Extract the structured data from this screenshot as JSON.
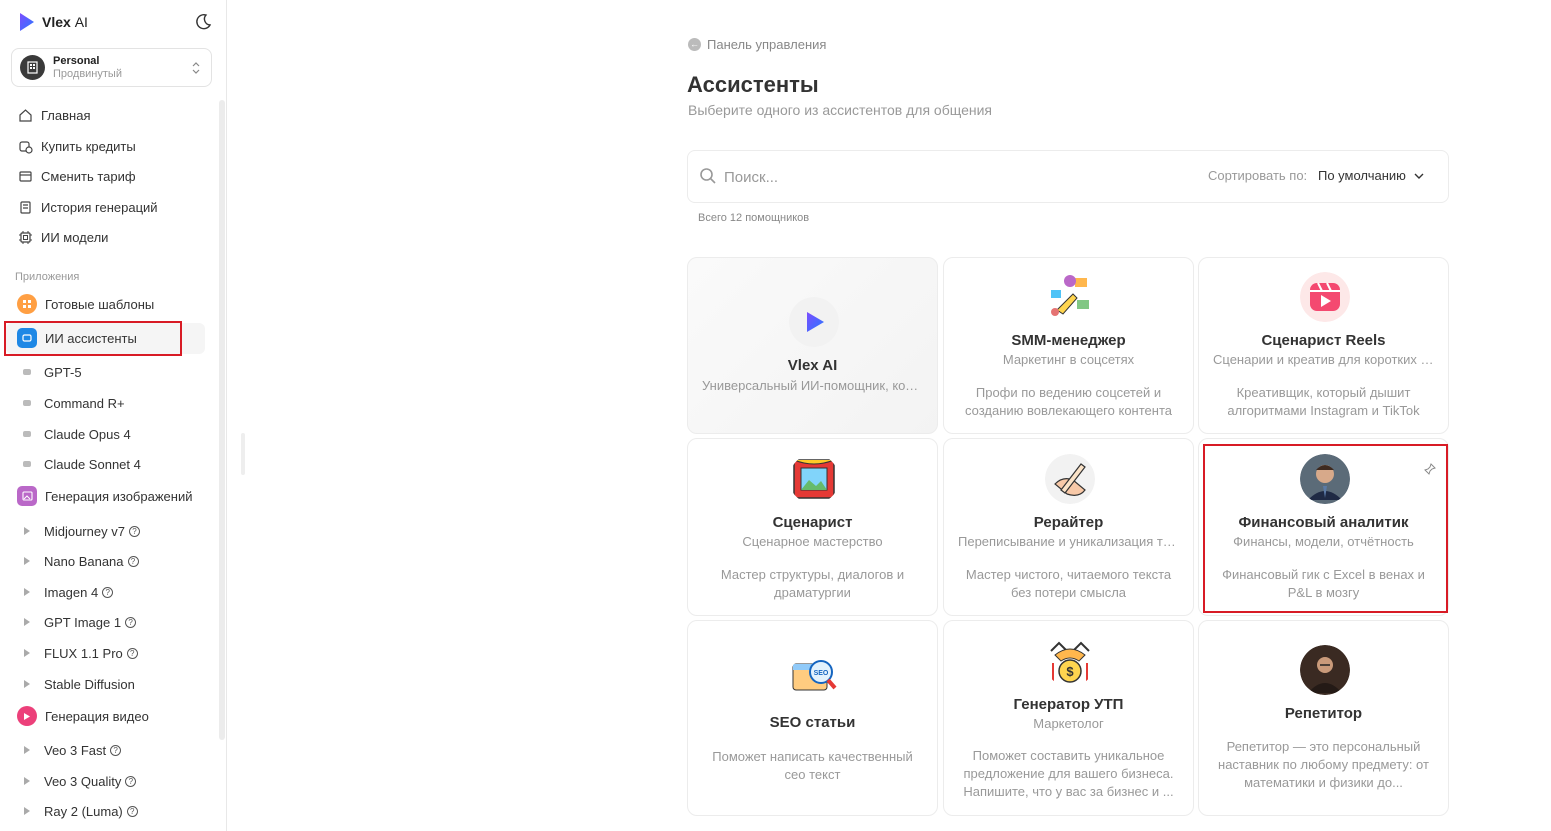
{
  "app": {
    "name": "Vlex",
    "name_suffix": "AI"
  },
  "workspace": {
    "name": "Personal",
    "plan": "Продвинутый"
  },
  "nav": [
    {
      "label": "Главная",
      "icon": "home-icon"
    },
    {
      "label": "Купить кредиты",
      "icon": "credits-icon"
    },
    {
      "label": "Сменить тариф",
      "icon": "plan-icon"
    },
    {
      "label": "История генераций",
      "icon": "history-icon"
    },
    {
      "label": "ИИ модели",
      "icon": "chip-icon"
    }
  ],
  "apps_section_label": "Приложения",
  "apps": {
    "templates": "Готовые шаблоны",
    "assistants": "ИИ ассистенты",
    "assistant_models": [
      "GPT-5",
      "Command R+",
      "Claude Opus 4",
      "Claude Sonnet 4"
    ],
    "image_gen": "Генерация изображений",
    "image_models": [
      "Midjourney v7",
      "Nano Banana",
      "Imagen 4",
      "GPT Image 1",
      "FLUX 1.1 Pro",
      "Stable Diffusion"
    ],
    "video_gen": "Генерация видео",
    "video_models": [
      "Veo 3 Fast",
      "Veo 3 Quality",
      "Ray 2 (Luma)"
    ]
  },
  "main": {
    "back_label": "Панель управления",
    "title": "Ассистенты",
    "subtitle": "Выберите одного из ассистентов для общения",
    "search_placeholder": "Поиск...",
    "sort_label": "Сортировать по:",
    "sort_value": "По умолчанию",
    "count_label": "Всего 12 помощников"
  },
  "cards": [
    {
      "title": "Vlex AI",
      "subtitle": "Универсальный ИИ-помощник, который поможет решить любые задачи",
      "description": ""
    },
    {
      "title": "SMM-менеджер",
      "subtitle": "Маркетинг в соцсетях",
      "description": "Профи по ведению соцсетей и созданию вовлекающего контента"
    },
    {
      "title": "Сценарист Reels",
      "subtitle": "Сценарии и креатив для коротких видео",
      "description": "Креативщик, который дышит алгоритмами Instagram и TikTok"
    },
    {
      "title": "Сценарист",
      "subtitle": "Сценарное мастерство",
      "description": "Мастер структуры, диалогов и драматургии"
    },
    {
      "title": "Рерайтер",
      "subtitle": "Переписывание и уникализация текстов",
      "description": "Мастер чистого, читаемого текста без потери смысла"
    },
    {
      "title": "Финансовый аналитик",
      "subtitle": "Финансы, модели, отчётность",
      "description": "Финансовый гик с Excel в венах и P&L в мозгу"
    },
    {
      "title": "SEO статьи",
      "subtitle": "",
      "description": "Поможет написать качественный сео текст"
    },
    {
      "title": "Генератор УТП",
      "subtitle": "Маркетолог",
      "description": "Поможет составить уникальное предложение для вашего бизнеса. Напишите, что у вас за бизнес и ..."
    },
    {
      "title": "Репетитор",
      "subtitle": "",
      "description": "Репетитор — это персональный наставник по любому предмету: от математики и физики до..."
    }
  ],
  "colors": {
    "highlight": "#d81b25",
    "brand": "#3d5afe"
  }
}
